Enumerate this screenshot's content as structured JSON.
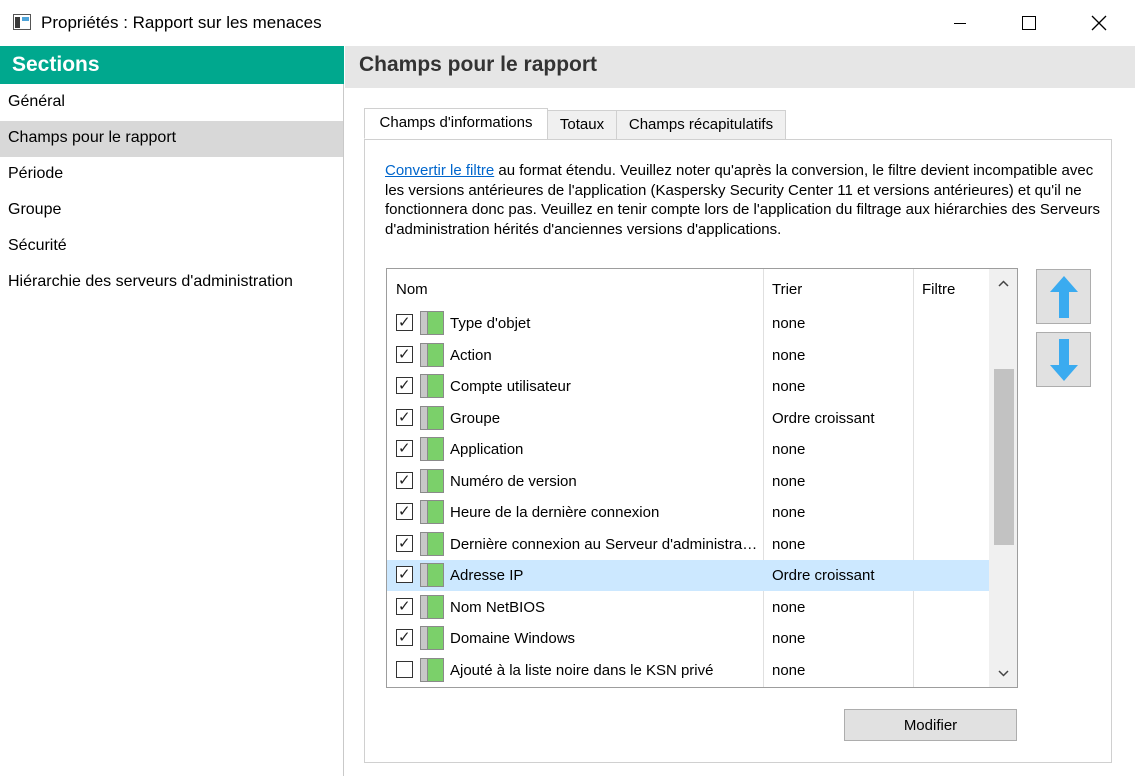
{
  "window": {
    "title": "Propriétés : Rapport sur les menaces"
  },
  "sidebar": {
    "header": "Sections",
    "items": [
      {
        "label": "Général"
      },
      {
        "label": "Champs pour le rapport",
        "active": true
      },
      {
        "label": "Période"
      },
      {
        "label": "Groupe"
      },
      {
        "label": "Sécurité"
      },
      {
        "label": "Hiérarchie des serveurs d'administration"
      }
    ]
  },
  "main": {
    "title": "Champs pour le rapport",
    "tabs": [
      {
        "label": "Champs d'informations",
        "active": true
      },
      {
        "label": "Totaux"
      },
      {
        "label": "Champs récapitulatifs"
      }
    ],
    "description": {
      "link": "Convertir le filtre",
      "text": " au format étendu. Veuillez noter qu'après la conversion, le filtre devient incompatible avec les versions antérieures de l'application (Kaspersky Security Center 11 et versions antérieures) et qu'il ne fonctionnera donc pas. Veuillez en tenir compte lors de l'application du filtrage aux hiérarchies des Serveurs d'administration hérités d'anciennes versions d'applications."
    },
    "table": {
      "columns": [
        "Nom",
        "Trier",
        "Filtre"
      ],
      "rows": [
        {
          "name": "Type d'objet",
          "sort": "none",
          "checked": true
        },
        {
          "name": "Action",
          "sort": "none",
          "checked": true
        },
        {
          "name": "Compte utilisateur",
          "sort": "none",
          "checked": true
        },
        {
          "name": "Groupe",
          "sort": "Ordre croissant",
          "checked": true
        },
        {
          "name": "Application",
          "sort": "none",
          "checked": true
        },
        {
          "name": "Numéro de version",
          "sort": "none",
          "checked": true
        },
        {
          "name": "Heure de la dernière connexion",
          "sort": "none",
          "checked": true
        },
        {
          "name": "Dernière connexion au Serveur d'administration",
          "sort": "none",
          "checked": true
        },
        {
          "name": "Adresse IP",
          "sort": "Ordre croissant",
          "checked": true,
          "selected": true
        },
        {
          "name": "Nom NetBIOS",
          "sort": "none",
          "checked": true
        },
        {
          "name": "Domaine Windows",
          "sort": "none",
          "checked": true
        },
        {
          "name": "Ajouté à la liste noire dans le KSN privé",
          "sort": "none",
          "checked": false
        }
      ]
    },
    "modify_button": "Modifier"
  },
  "colors": {
    "accent": "#00a88e",
    "arrow_blue": "#3aabf0",
    "selection": "#cce8ff",
    "link": "#0066cc"
  },
  "icons": {
    "move_up": "arrow-up-icon",
    "move_down": "arrow-down-icon",
    "column": "column-field-icon"
  }
}
